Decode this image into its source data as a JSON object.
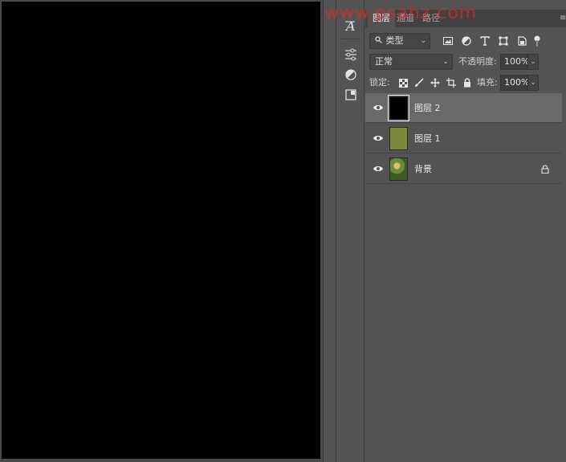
{
  "tabs": [
    {
      "label": "图层",
      "active": true
    },
    {
      "label": "通道",
      "active": false
    },
    {
      "label": "路径",
      "active": false
    }
  ],
  "filter": {
    "kind_label": "类型"
  },
  "blend": {
    "mode": "正常",
    "opacity_label": "不透明度:",
    "opacity_value": "100%"
  },
  "lock": {
    "label": "锁定:",
    "fill_label": "填充:",
    "fill_value": "100%"
  },
  "layers": [
    {
      "name": "图层 2",
      "thumb_color": "#000000",
      "selected": true,
      "locked": false
    },
    {
      "name": "图层 1",
      "thumb_color": "#7d8a3c",
      "selected": false,
      "locked": false
    },
    {
      "name": "背景",
      "thumb_color": "#5a7a3a",
      "selected": false,
      "locked": true
    }
  ],
  "watermark": "www.psahz.com",
  "colors": {
    "panel_bg": "#535353",
    "tab_bar_bg": "#424242",
    "selected_layer_bg": "#696969",
    "canvas": "#000000",
    "watermark": "#dc2828"
  },
  "icons": {
    "toolstrip": [
      "text-tool-icon",
      "adjustments-icon",
      "color-circle-icon",
      "properties-icon"
    ],
    "filter": [
      "image-filter-icon",
      "adjustment-filter-icon",
      "type-filter-icon",
      "shape-filter-icon",
      "smart-object-filter-icon",
      "filter-toggle-icon"
    ],
    "lock": [
      "lock-transparent-icon",
      "lock-brush-icon",
      "lock-position-icon",
      "lock-artboard-icon",
      "lock-all-icon"
    ]
  }
}
